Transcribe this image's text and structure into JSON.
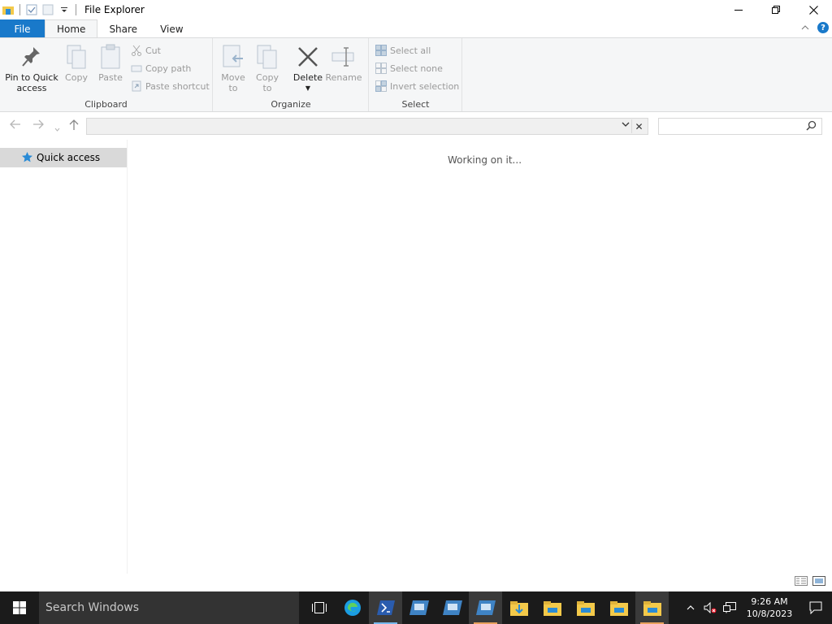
{
  "window": {
    "title": "File Explorer"
  },
  "tabs": [
    {
      "label": "File"
    },
    {
      "label": "Home"
    },
    {
      "label": "Share"
    },
    {
      "label": "View"
    }
  ],
  "ribbon": {
    "clipboard": {
      "label": "Clipboard",
      "pin_line1": "Pin to Quick",
      "pin_line2": "access",
      "copy": "Copy",
      "paste": "Paste",
      "cut": "Cut",
      "copy_path": "Copy path",
      "paste_shortcut": "Paste shortcut"
    },
    "organize": {
      "label": "Organize",
      "move_line1": "Move",
      "move_line2": "to",
      "copy_line1": "Copy",
      "copy_line2": "to",
      "delete": "Delete",
      "rename": "Rename"
    },
    "select": {
      "label": "Select",
      "select_all": "Select all",
      "select_none": "Select none",
      "invert": "Invert selection"
    }
  },
  "navpane": {
    "quick_access": "Quick access"
  },
  "content": {
    "status": "Working on it..."
  },
  "taskbar": {
    "search_placeholder": "Search Windows",
    "time": "9:26 AM",
    "date": "10/8/2023"
  }
}
